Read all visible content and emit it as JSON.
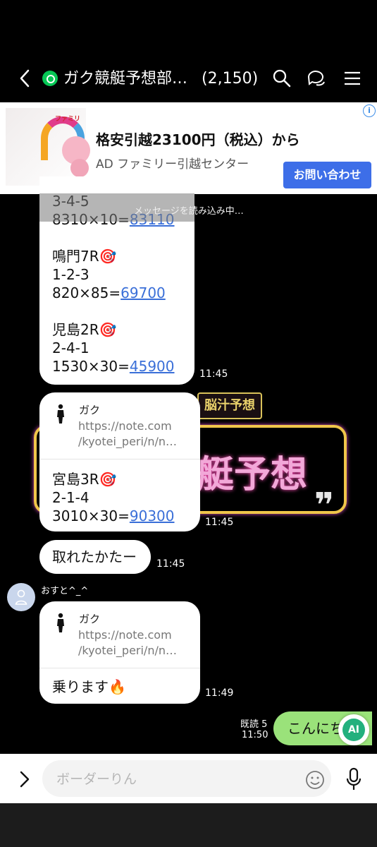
{
  "header": {
    "title": "ガク競艇予想部…",
    "member_count": "(2,150)"
  },
  "ad": {
    "title": "格安引越23100円（税込）から",
    "label": "AD",
    "advertiser": "ファミリー引越センター",
    "cta": "お問い合わせ",
    "info_icon": "i",
    "thumb_logo": "ファミリ"
  },
  "loading_text": "メッセージを読み込み中…",
  "background_art": {
    "banner": "脳汁予想",
    "big_text": "艇予想",
    "quote": "❞"
  },
  "messages": [
    {
      "lines": [
        "3-4-5",
        "8310×10="
      ],
      "link": "83110",
      "race2": [
        "鳴門7R🎯",
        "1-2-3",
        "820×85="
      ],
      "link2": "69700",
      "race3": [
        "児島2R🎯",
        "2-4-1",
        "1530×30="
      ],
      "link3": "45900",
      "time": "11:45"
    },
    {
      "card_name": "ガク",
      "card_url_1": "https://note.com",
      "card_url_2": "/kyotei_peri/n/n…",
      "lines": [
        "宮島3R🎯",
        "2-1-4",
        "3010×30="
      ],
      "link": "90300",
      "time": "11:45"
    },
    {
      "text": "取れたかたー",
      "time": "11:45"
    },
    {
      "sender": "おすと^_^",
      "card_name": "ガク",
      "card_url_1": "https://note.com",
      "card_url_2": "/kyotei_peri/n/n…",
      "text": "乗ります🔥",
      "time": "11:49"
    }
  ],
  "sent": {
    "read": "既読 5",
    "time": "11:50",
    "text": "こんにち",
    "ai_label": "AI"
  },
  "composer": {
    "value": "",
    "placeholder": "ボーダーりん"
  }
}
